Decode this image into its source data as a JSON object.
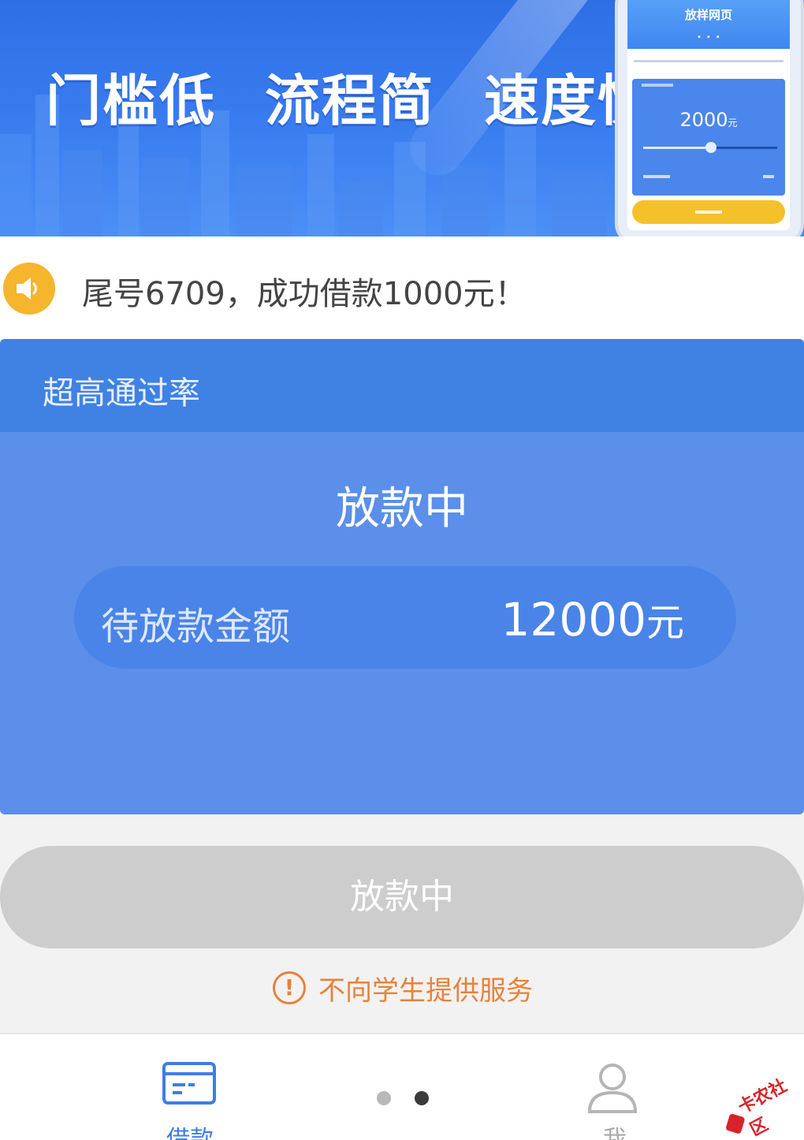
{
  "banner": {
    "slogans": [
      "门槛低",
      "流程简",
      "速度快"
    ],
    "phone_preview": {
      "title": "放样网页",
      "amount": "2000",
      "unit": "元"
    }
  },
  "notice": {
    "icon": "speaker-icon",
    "text": "尾号6709，成功借款1000元！"
  },
  "card": {
    "header": "超高通过率",
    "status": "放款中",
    "amount_label": "待放款金额",
    "amount_value": "12000",
    "amount_unit": "元"
  },
  "action_button": {
    "label": "放款中"
  },
  "warning": {
    "icon": "exclamation-icon",
    "text": "不向学生提供服务"
  },
  "tabbar": {
    "tabs": [
      {
        "label": "借款",
        "icon": "card-icon",
        "active": true
      },
      {
        "label": "我",
        "icon": "user-icon",
        "active": false
      }
    ],
    "pager": {
      "total": 2,
      "active": 2
    }
  },
  "watermark": {
    "text": "卡农社区"
  },
  "colors": {
    "primary": "#3f82e4",
    "card_body": "#5b8fe9",
    "warning": "#e8823a",
    "speaker": "#f5b52d",
    "disabled_button": "#cdcdcd"
  }
}
